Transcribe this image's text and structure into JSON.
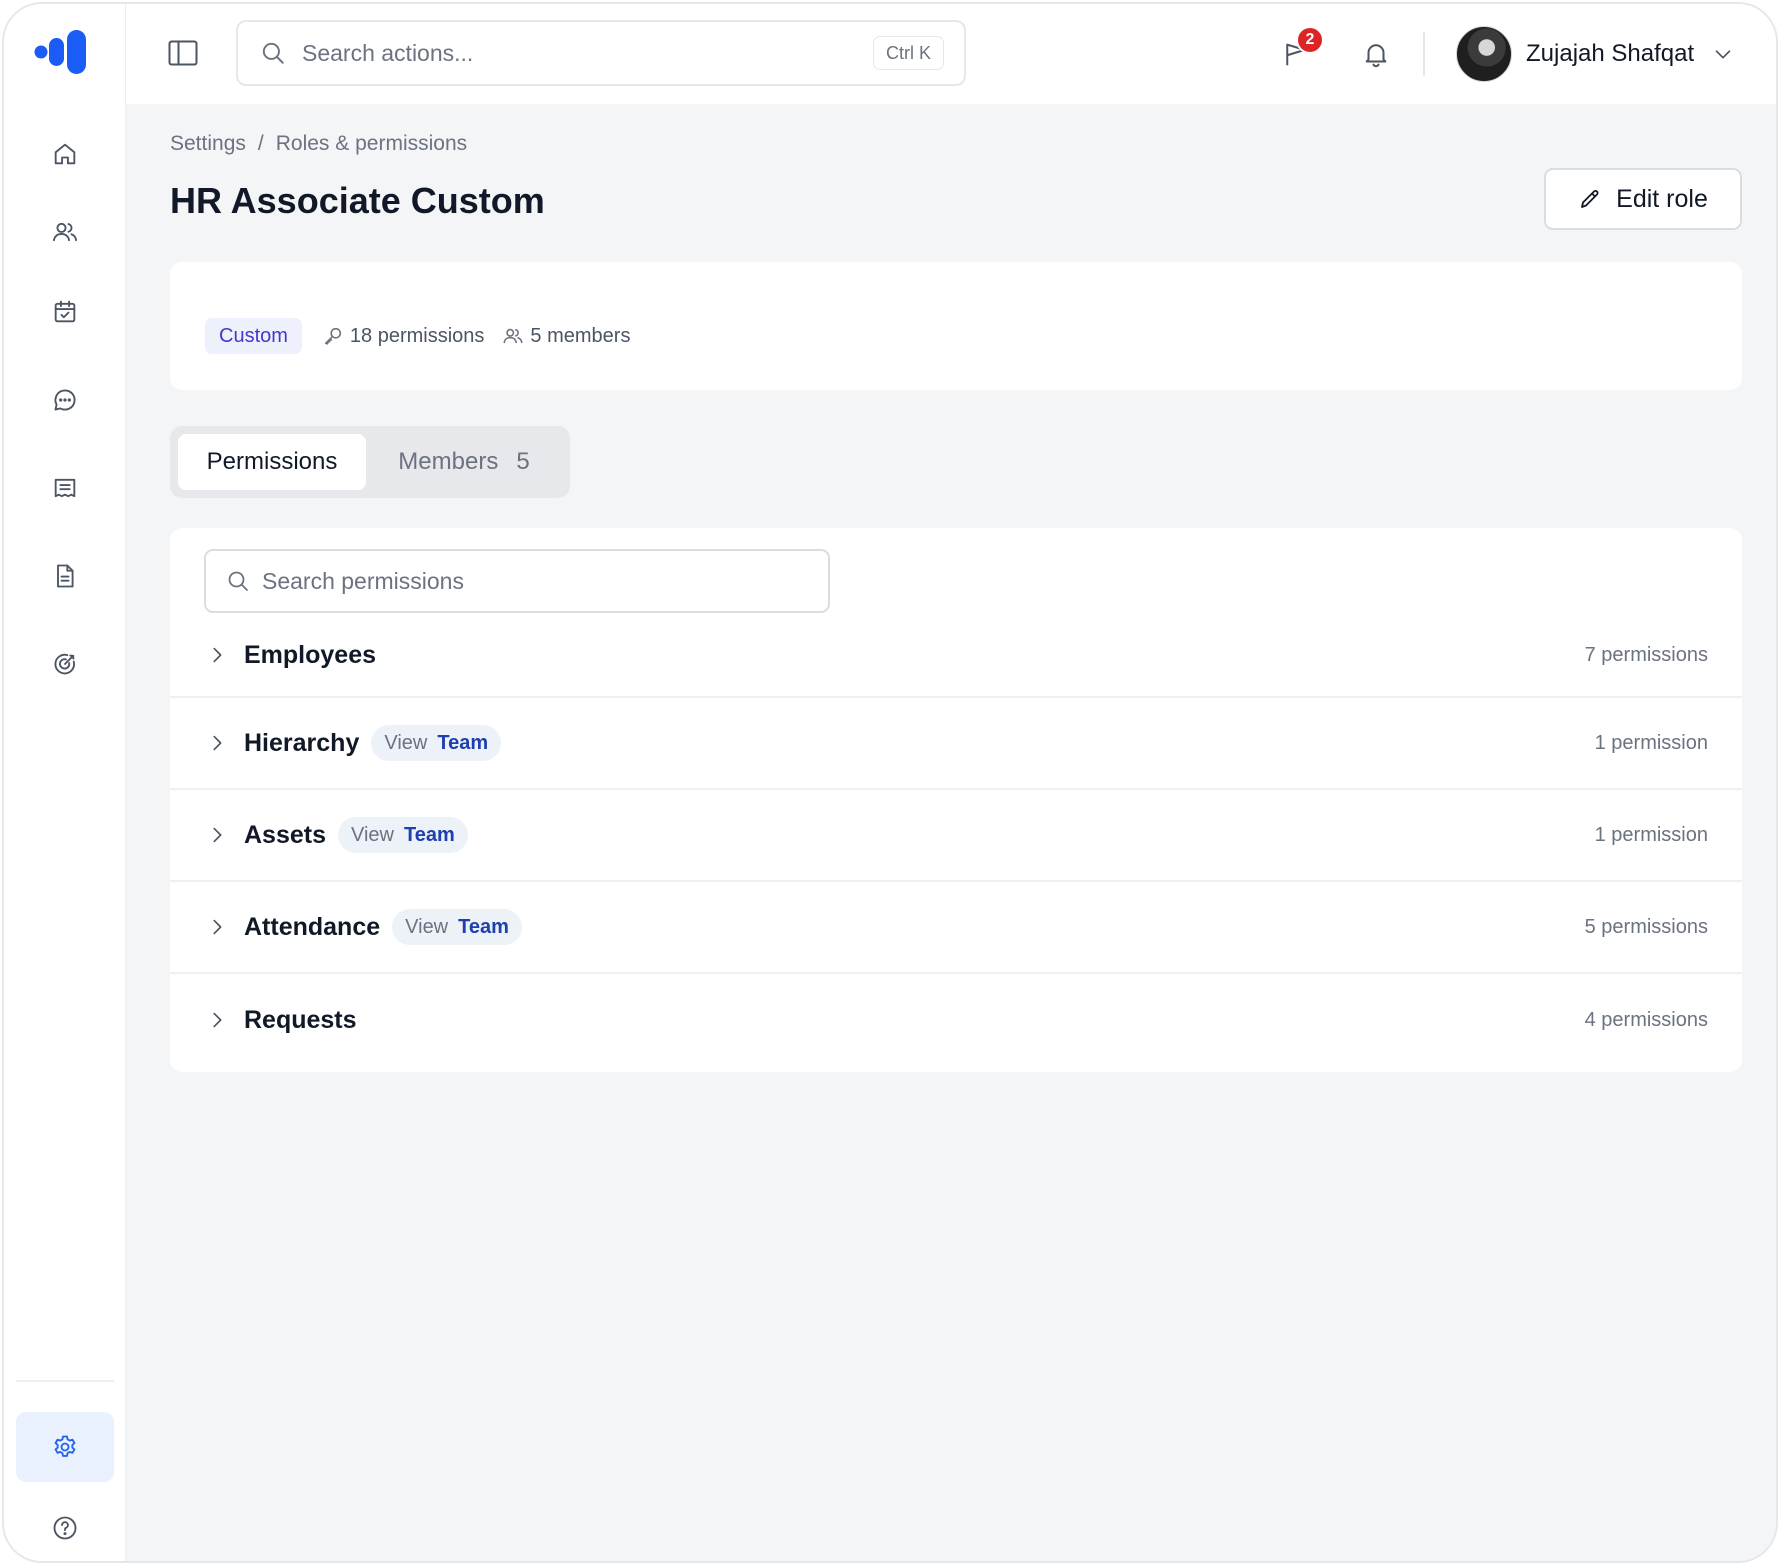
{
  "topbar": {
    "search_placeholder": "Search actions...",
    "search_shortcut": "Ctrl K",
    "announcements_badge": "2",
    "user_name": "Zujajah Shafqat"
  },
  "breadcrumb": {
    "parent": "Settings",
    "separator": "/",
    "current": "Roles & permissions"
  },
  "page": {
    "title": "HR Associate Custom",
    "edit_label": "Edit role"
  },
  "summary": {
    "tag": "Custom",
    "permissions_count": "18 permissions",
    "members_count": "5 members"
  },
  "tabs": {
    "permissions_label": "Permissions",
    "members_label": "Members",
    "members_count": "5"
  },
  "permissions": {
    "search_placeholder": "Search permissions",
    "groups": [
      {
        "name": "Employees",
        "count": "7 permissions"
      },
      {
        "name": "Hierarchy",
        "scope_action": "View",
        "scope_level": "Team",
        "count": "1 permission"
      },
      {
        "name": "Assets",
        "scope_action": "View",
        "scope_level": "Team",
        "count": "1 permission"
      },
      {
        "name": "Attendance",
        "scope_action": "View",
        "scope_level": "Team",
        "count": "5 permissions"
      },
      {
        "name": "Requests",
        "count": "4 permissions"
      }
    ]
  },
  "colors": {
    "brand": "#1a5cf5",
    "active_nav_bg": "#eaf1fe",
    "badge": "#dc2626",
    "tag_custom_text": "#4338ca",
    "scope_team_text": "#1e40af"
  },
  "icons": {
    "sidebar": [
      "home-icon",
      "users-icon",
      "calendar-check-icon",
      "chat-icon",
      "receipt-icon",
      "document-icon",
      "target-icon",
      "settings-icon",
      "help-icon"
    ]
  }
}
